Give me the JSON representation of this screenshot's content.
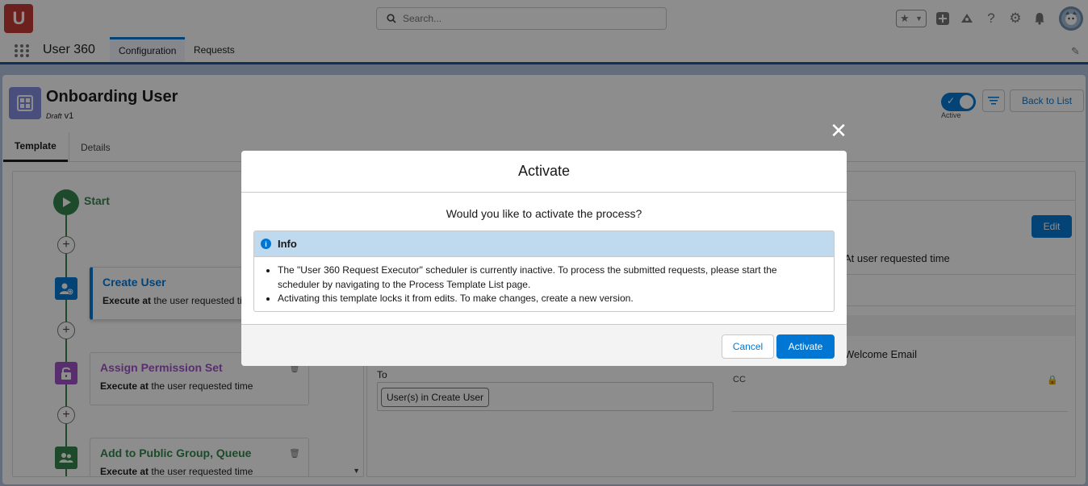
{
  "header": {
    "logo_text": "U",
    "search_placeholder": "Search...",
    "icons": [
      "favorites-star-icon",
      "add-icon",
      "trailhead-icon",
      "help-icon",
      "setup-gear-icon",
      "notification-bell-icon",
      "user-avatar"
    ]
  },
  "nav": {
    "app_name": "User 360",
    "tabs": [
      {
        "label": "Configuration",
        "active": true
      },
      {
        "label": "Requests",
        "active": false
      }
    ]
  },
  "record": {
    "title": "Onboarding User",
    "status": "Draft",
    "version": "v1",
    "toggle_label": "Active",
    "back_button": "Back to List",
    "tabs": [
      {
        "label": "Template",
        "active": true
      },
      {
        "label": "Details",
        "active": false
      }
    ]
  },
  "flow": {
    "start_label": "Start",
    "steps": [
      {
        "title": "Create User",
        "desc_bold": "Execute at",
        "desc_rest": " the user requested time",
        "color": "#0176d3",
        "icon": "add-user-icon"
      },
      {
        "title": "Assign Permission Set",
        "desc_bold": "Execute at",
        "desc_rest": " the user requested time",
        "color": "#9e51c6",
        "icon": "unlock-icon"
      },
      {
        "title": "Add to Public Group, Queue",
        "desc_bold": "Execute at",
        "desc_rest": " the user requested time",
        "color": "#2e844a",
        "icon": "group-icon"
      }
    ]
  },
  "detail_panel": {
    "edit_label": "Edit",
    "time_text": "At user requested time",
    "welcome_text": "Welcome Email",
    "to_label": "To",
    "to_value": "User(s) in Create User",
    "cc_label": "CC"
  },
  "modal": {
    "title": "Activate",
    "question": "Would you like to activate the process?",
    "info_title": "Info",
    "info_items": [
      "The \"User 360 Request Executor\" scheduler is currently inactive. To process the submitted requests, please start the scheduler by navigating to the Process Template List page.",
      "Activating this template locks it from edits. To make changes, create a new version."
    ],
    "cancel_label": "Cancel",
    "activate_label": "Activate"
  },
  "colors": {
    "brand": "#0176d3",
    "logo": "#c23934",
    "success": "#2e844a",
    "purple": "#9e51c6"
  }
}
